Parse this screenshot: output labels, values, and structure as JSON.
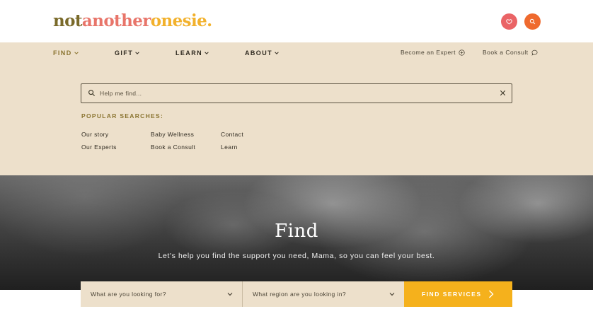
{
  "header": {
    "logo": {
      "part1": "not",
      "part2": "another",
      "part3": "onesie."
    },
    "icons": {
      "wishlist": "heart-icon",
      "search": "search-icon"
    },
    "colors": {
      "logo_olive": "#7a6a2a",
      "logo_coral": "#e8756a",
      "logo_gold": "#f2b12c",
      "heart_button": "#ea6466",
      "search_button": "#ef6a2e"
    }
  },
  "nav": {
    "items": [
      {
        "label": "FIND",
        "active": true
      },
      {
        "label": "GIFT",
        "active": false
      },
      {
        "label": "LEARN",
        "active": false
      },
      {
        "label": "ABOUT",
        "active": false
      }
    ],
    "right": [
      {
        "label": "Become an Expert",
        "icon": "plus-circle-icon"
      },
      {
        "label": "Book a Consult",
        "icon": "chat-bubble-icon"
      }
    ]
  },
  "search": {
    "placeholder": "Help me find...",
    "value": "",
    "search_icon": "search-icon",
    "clear_icon": "close-icon"
  },
  "popular": {
    "title": "POPULAR SEARCHES:",
    "links": [
      "Our story",
      "Baby Wellness",
      "Contact",
      "Our Experts",
      "Book a Consult",
      "Learn"
    ]
  },
  "hero": {
    "title": "Find",
    "subtitle": "Let's help you find the support you need, Mama, so you can feel your best."
  },
  "finder": {
    "what_placeholder": "What are you looking for?",
    "region_placeholder": "What region are you looking in?",
    "button_label": "FIND SERVICES",
    "button_color": "#f5b11c",
    "panel_color": "#ede0cb"
  }
}
